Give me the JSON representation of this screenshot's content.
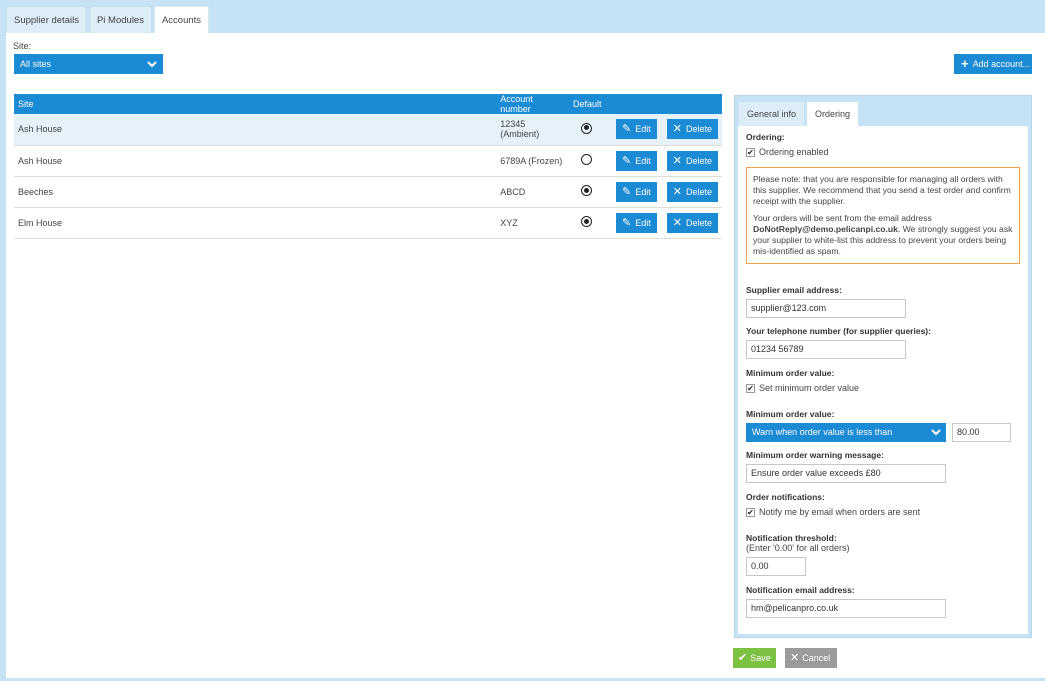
{
  "tabs": [
    "Supplier details",
    "Pi Modules",
    "Accounts"
  ],
  "site": {
    "label": "Site:",
    "selected": "All sites"
  },
  "add_account_label": "Add account...",
  "table": {
    "headers": {
      "site": "Site",
      "account": "Account number",
      "default": "Default"
    },
    "rows": [
      {
        "site": "Ash House",
        "account": "12345 (Ambient)",
        "default": true,
        "selected": true
      },
      {
        "site": "Ash House",
        "account": "6789A (Frozen)",
        "default": false,
        "selected": false
      },
      {
        "site": "Beeches",
        "account": "ABCD",
        "default": true,
        "selected": false
      },
      {
        "site": "Elm House",
        "account": "XYZ",
        "default": true,
        "selected": false
      }
    ],
    "edit_label": "Edit",
    "delete_label": "Delete"
  },
  "side_tabs": [
    "General info",
    "Ordering"
  ],
  "ordering": {
    "section_label": "Ordering:",
    "enabled_label": "Ordering enabled",
    "note_p1": "Please note: that you are responsible for managing all orders with this supplier. We recommend that you send a test order and confirm receipt with the supplier.",
    "note_p2_pre": "Your orders will be sent from the email address",
    "note_email": "DoNotReply@demo.pelicanpi.co.uk",
    "note_p2_post": ". We strongly suggest you ask your supplier to white-list this address to prevent your orders being mis-identified as spam.",
    "supplier_email_label": "Supplier email address:",
    "supplier_email": "supplier@123.com",
    "telephone_label": "Your telephone number (for supplier queries):",
    "telephone": "01234 56789",
    "min_order_label": "Minimum order value:",
    "set_min_label": "Set minimum order value",
    "min_value_label": "Minimum order value:",
    "warn_option": "Warn when order value is less than",
    "min_value": "80.00",
    "warning_msg_label": "Minimum order warning message:",
    "warning_msg": "Ensure order value exceeds £80",
    "notifications_label": "Order notifications:",
    "notify_label": "Notify me by email when orders are sent",
    "threshold_label": "Notification threshold:",
    "threshold_hint": "(Enter '0.00' for all orders)",
    "threshold": "0.00",
    "notify_email_label": "Notification email address:",
    "notify_email": "hm@pelicanpro.co.uk"
  },
  "save_label": "Save",
  "cancel_label": "Cancel",
  "colors": {
    "accent": "#1a8bd4",
    "save": "#7dc142",
    "cancel": "#9b9b9b",
    "note_border": "#f0a04b"
  }
}
